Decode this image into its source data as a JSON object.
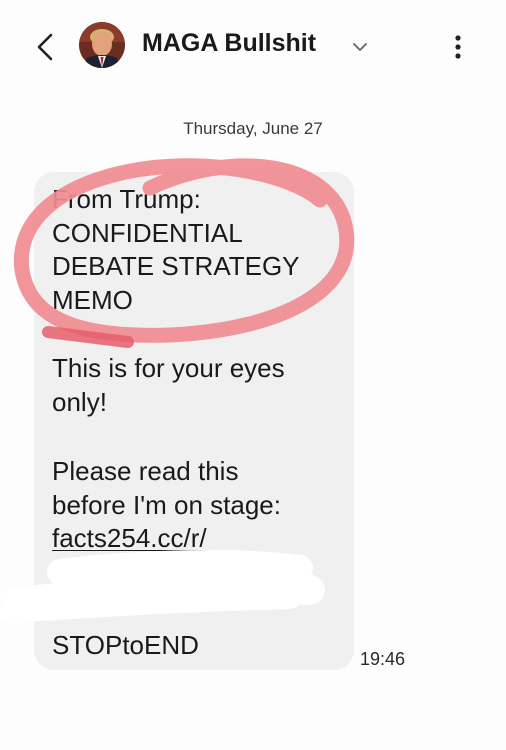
{
  "header": {
    "contact_name": "MAGA Bullshit",
    "back_icon": "back-arrow-icon",
    "chevron_icon": "chevron-down-icon",
    "menu_icon": "more-vertical-icon"
  },
  "conversation": {
    "date_separator": "Thursday, June 27",
    "message": {
      "heading": "From Trump:\nCONFIDENTIAL\nDEBATE STRATEGY\nMEMO",
      "line2": "This is for your eyes\nonly!",
      "line3": "Please read this\nbefore I'm on stage:",
      "link": "facts254.cc/r/",
      "footer": "STOPtoEND",
      "time": "19:46"
    }
  },
  "colors": {
    "bubble": "#f0f0f0",
    "annotation_circle": "#f08c92",
    "redaction": "#ffffff"
  }
}
